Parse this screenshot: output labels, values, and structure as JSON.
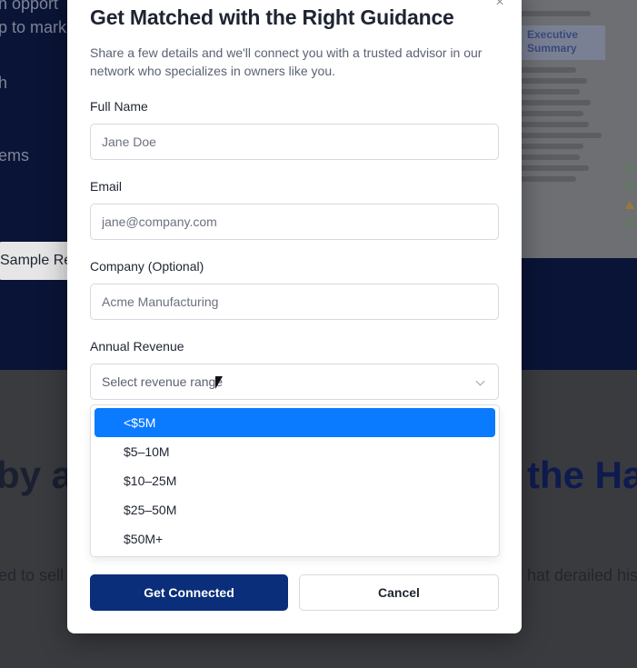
{
  "background": {
    "hero_lines": [
      "n opport",
      "p to mark",
      "h",
      "ems"
    ],
    "sample_button": "Sample Re",
    "exec_card": "Executive Summary",
    "big_heading_left": "by a",
    "big_heading_right": "the Ha",
    "paragraph_left": "ed to sell",
    "paragraph_right": "hat derailed his"
  },
  "modal": {
    "close_icon": "×",
    "title": "Get Matched with the Right Guidance",
    "subtitle": "Share a few details and we'll connect you with a trusted advisor in our network who specializes in owners like you.",
    "fields": {
      "full_name": {
        "label": "Full Name",
        "placeholder": "Jane Doe"
      },
      "email": {
        "label": "Email",
        "placeholder": "jane@company.com"
      },
      "company": {
        "label": "Company (Optional)",
        "placeholder": "Acme Manufacturing"
      },
      "revenue": {
        "label": "Annual Revenue",
        "placeholder": "Select revenue range",
        "options": [
          "<$5M",
          "$5–10M",
          "$10–25M",
          "$25–50M",
          "$50M+"
        ],
        "highlighted_index": 0
      }
    },
    "primary_button": "Get Connected",
    "secondary_button": "Cancel"
  },
  "colors": {
    "primary": "#0a2e7a",
    "option_highlight": "#0a7aff",
    "hero_bg": "#0a1436"
  }
}
